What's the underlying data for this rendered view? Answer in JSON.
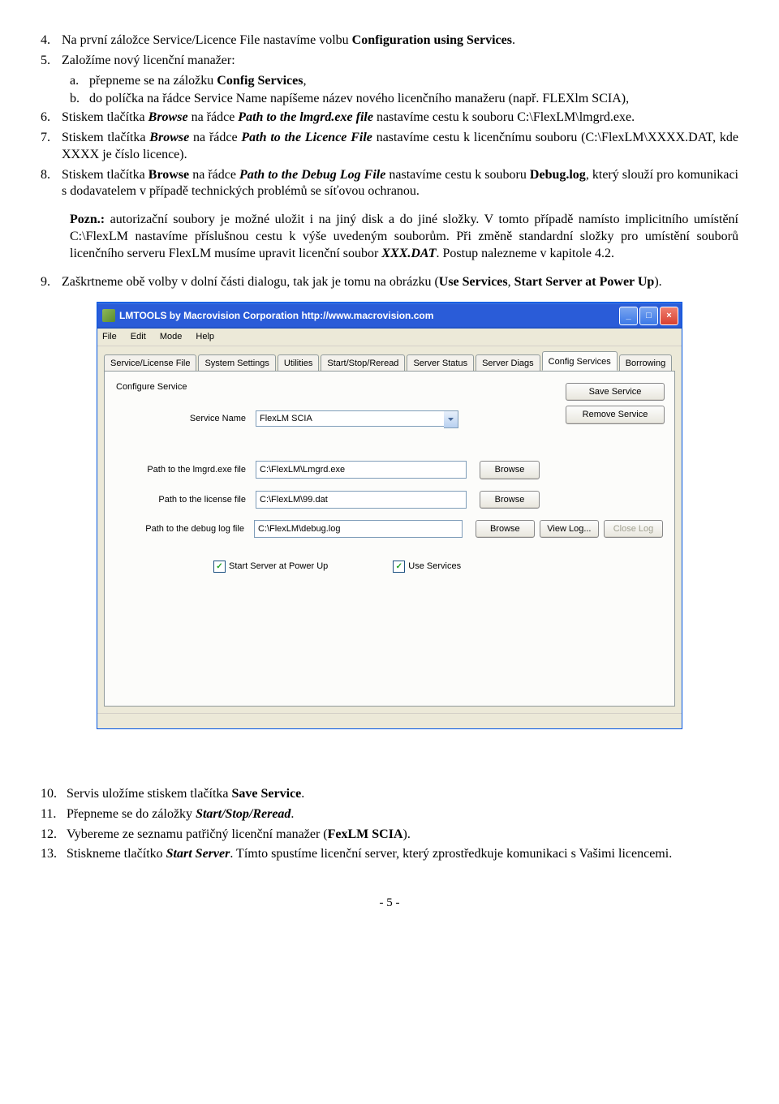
{
  "doc": {
    "items": [
      {
        "n": "4.",
        "t": "Na první záložce Service/Licence File nastavíme volbu ",
        "b1": "Configuration using Services",
        "t2": "."
      },
      {
        "n": "5.",
        "t": "Založíme nový licenční manažer:",
        "subs": [
          {
            "n": "a.",
            "t": "přepneme se na záložku ",
            "b": "Config Services",
            "t2": ","
          },
          {
            "n": "b.",
            "t": "do políčka na řádce Service Name napíšeme název nového licenčního manažeru (např. FLEXlm SCIA),"
          }
        ]
      },
      {
        "n": "6.",
        "t": "Stiskem tlačítka ",
        "bi1": "Browse",
        "t2": " na řádce ",
        "bi2": "Path to the lmgrd.exe file",
        "t3": " nastavíme cestu k souboru C:\\FlexLM\\lmgrd.exe."
      },
      {
        "n": "7.",
        "t": "Stiskem tlačítka ",
        "bi1": "Browse",
        "t2": " na řádce ",
        "bi2": "Path to the Licence File",
        "t3": " nastavíme cestu k  licenčnímu souboru (C:\\FlexLM\\XXXX.DAT, kde XXXX je číslo licence)."
      },
      {
        "n": "8.",
        "t": "Stiskem tlačítka ",
        "b1": "Browse",
        "t2": " na řádce ",
        "bi2": "Path to the Debug Log File",
        "t3": " nastavíme cestu k souboru ",
        "b2": "Debug.log",
        "t4": ", který slouží pro komunikaci s dodavatelem v případě technických problémů se síťovou ochranou."
      }
    ],
    "pozn_label": "Pozn.:",
    "pozn": " autorizační soubory je možné uložit i na jiný disk a do jiné složky. V tomto případě namísto implicitního umístění C:\\FlexLM nastavíme příslušnou cestu k výše uvedeným souborům. Při změně standardní složky pro umístění souborů licenčního serveru FlexLM musíme upravit licenční soubor ",
    "pozn_bi": "XXX.DAT",
    "pozn2": ". Postup nalezneme v kapitole 4.2.",
    "item9": {
      "n": "9.",
      "t": "Zaškrtneme obě volby v dolní části dialogu, tak jak je tomu na obrázku (",
      "b1": "Use Services",
      "t2": ", ",
      "b2": "Start Server at Power Up",
      "t3": ")."
    },
    "bottom": [
      {
        "n": "10.",
        "t": "Servis uložíme stiskem tlačítka ",
        "b": "Save Service",
        "t2": "."
      },
      {
        "n": "11.",
        "t": "Přepneme se do záložky ",
        "bi": "Start/Stop/Reread",
        "t2": "."
      },
      {
        "n": "12.",
        "t": "Vybereme ze seznamu patřičný licenční manažer (",
        "b": "FexLM SCIA",
        "t2": ")."
      },
      {
        "n": "13.",
        "t": "Stiskneme tlačítko ",
        "bi": "Start Server",
        "t2": ". Tímto spustíme licenční server, který zprostředkuje komunikaci s Vašimi licencemi."
      }
    ],
    "page": "- 5 -"
  },
  "win": {
    "title": "LMTOOLS by Macrovision Corporation http://www.macrovision.com",
    "menu": [
      "File",
      "Edit",
      "Mode",
      "Help"
    ],
    "tabs": [
      "Service/License File",
      "System Settings",
      "Utilities",
      "Start/Stop/Reread",
      "Server Status",
      "Server Diags",
      "Config Services",
      "Borrowing"
    ],
    "active_tab": 6,
    "configure_service": "Configure Service",
    "labels": {
      "service_name": "Service Name",
      "lmgrd": "Path to the lmgrd.exe file",
      "license": "Path to the license file",
      "debug": "Path to the debug log file"
    },
    "values": {
      "service_name": "FlexLM SCIA",
      "lmgrd": "C:\\FlexLM\\Lmgrd.exe",
      "license": "C:\\FlexLM\\99.dat",
      "debug": "C:\\FlexLM\\debug.log"
    },
    "buttons": {
      "save": "Save Service",
      "remove": "Remove Service",
      "browse": "Browse",
      "viewlog": "View Log...",
      "closelog": "Close Log"
    },
    "checks": {
      "start": "Start Server at Power Up",
      "use": "Use Services"
    }
  }
}
